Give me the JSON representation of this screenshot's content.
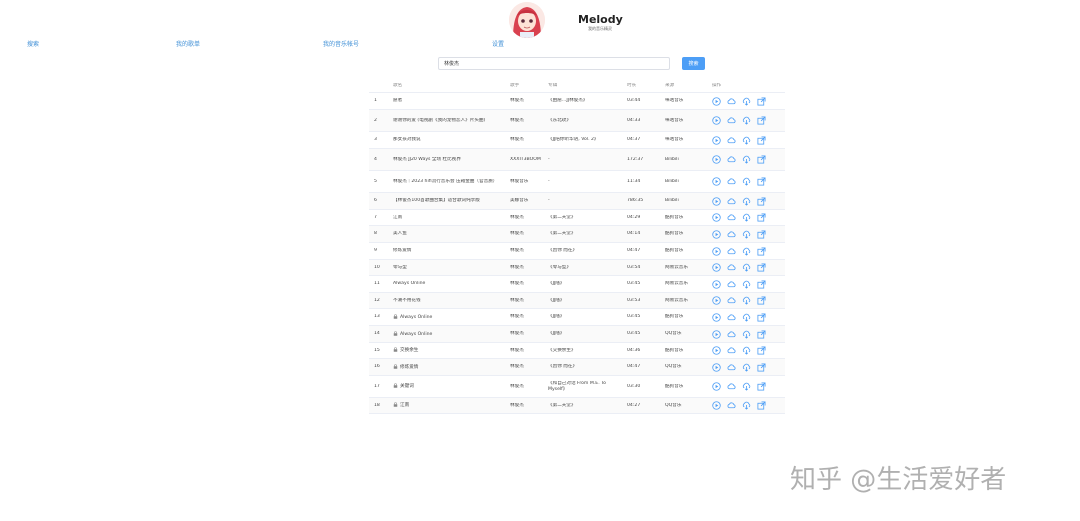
{
  "header": {
    "title": "Melody",
    "subtitle": "我的音乐精灵"
  },
  "nav": {
    "search": "搜索",
    "my_songs": "我的歌单",
    "music_account": "我的音乐帐号",
    "settings": "设置"
  },
  "search": {
    "value": "林俊杰",
    "button": "搜索"
  },
  "table": {
    "columns": [
      "歌名",
      "歌手",
      "专辑",
      "时长",
      "来源",
      "操作"
    ],
    "rows": [
      {
        "idx": "1",
        "title": "愿者",
        "artist": "林俊杰",
        "album": "《由愿…JJ林俊杰》",
        "duration": "03:44",
        "source": "咪咕音乐",
        "locked": false
      },
      {
        "idx": "2",
        "title": "谢谢你的爱 (电视剧《我的宠物恋人》片头曲)",
        "artist": "林俊杰",
        "album": "《东北玫》",
        "duration": "04:33",
        "source": "咪咕音乐",
        "locked": false
      },
      {
        "idx": "3",
        "title": "那女孩对我说",
        "artist": "林俊杰",
        "album": "《JJ陪你听华语, Vol. 2》",
        "duration": "04:37",
        "source": "咪咕音乐",
        "locked": false
      },
      {
        "idx": "4",
        "title": "林俊杰 JJ20 Ways 全场 杜比视界",
        "artist": "XXXIT3BOOM",
        "album": "-",
        "duration": "172:37",
        "source": "Bilibili",
        "locked": false
      },
      {
        "idx": "5",
        "title": "林俊杰｜2023 hifi流行音乐会 压箱金曲（官音质）",
        "artist": "林俊音乐",
        "album": "-",
        "duration": "11:34",
        "source": "Bilibili",
        "locked": false
      },
      {
        "idx": "6",
        "title": "【林俊杰100首歌曲合集】适合歌词纯享版",
        "artist": "美娜音乐",
        "album": "-",
        "duration": "786:35",
        "source": "Bilibili",
        "locked": false
      },
      {
        "idx": "7",
        "title": "江南",
        "artist": "林俊杰",
        "album": "《第二天堂》",
        "duration": "04:29",
        "source": "酷狗音乐",
        "locked": false
      },
      {
        "idx": "8",
        "title": "美人鱼",
        "artist": "林俊杰",
        "album": "《第二天堂》",
        "duration": "04:14",
        "source": "酷狗音乐",
        "locked": false
      },
      {
        "idx": "9",
        "title": "修炼爱情",
        "artist": "林俊杰",
        "album": "《因你 而在》",
        "duration": "04:47",
        "source": "酷狗音乐",
        "locked": false
      },
      {
        "idx": "10",
        "title": "零与型",
        "artist": "林俊杰",
        "album": "《零与型》",
        "duration": "03:54",
        "source": "网易云音乐",
        "locked": false
      },
      {
        "idx": "11",
        "title": "Always Online",
        "artist": "林俊杰",
        "album": "《JJ陆》",
        "duration": "03:45",
        "source": "网易云音乐",
        "locked": false
      },
      {
        "idx": "12",
        "title": "不潮不用花钱",
        "artist": "林俊杰",
        "album": "《JJ陆》",
        "duration": "03:53",
        "source": "网易云音乐",
        "locked": false
      },
      {
        "idx": "13",
        "title": "Always Online",
        "artist": "林俊杰",
        "album": "《JJ陆》",
        "duration": "03:45",
        "source": "酷狗音乐",
        "locked": true
      },
      {
        "idx": "14",
        "title": "Always Online",
        "artist": "林俊杰",
        "album": "《JJ陆》",
        "duration": "03:45",
        "source": "QQ音乐",
        "locked": true
      },
      {
        "idx": "15",
        "title": "交换余生",
        "artist": "林俊杰",
        "album": "《交换余生》",
        "duration": "04:36",
        "source": "酷狗音乐",
        "locked": true
      },
      {
        "idx": "16",
        "title": "修炼爱情",
        "artist": "林俊杰",
        "album": "《因你 而在》",
        "duration": "04:47",
        "source": "QQ音乐",
        "locked": true
      },
      {
        "idx": "17",
        "title": "关键词",
        "artist": "林俊杰",
        "album": "《和自己对话 From M.E. To Myself》",
        "duration": "03:30",
        "source": "酷狗音乐",
        "locked": true
      },
      {
        "idx": "18",
        "title": "江南",
        "artist": "林俊杰",
        "album": "《第二天堂》",
        "duration": "04:27",
        "source": "QQ音乐",
        "locked": true
      }
    ]
  },
  "icons": {
    "play": "play-icon",
    "cloud": "cloud-icon",
    "download": "download-icon",
    "open": "open-link-icon",
    "lock": "lock-icon"
  },
  "colors": {
    "accent": "#4d9ef6",
    "link": "#3f8fd6"
  },
  "watermark": "知乎 @生活爱好者"
}
